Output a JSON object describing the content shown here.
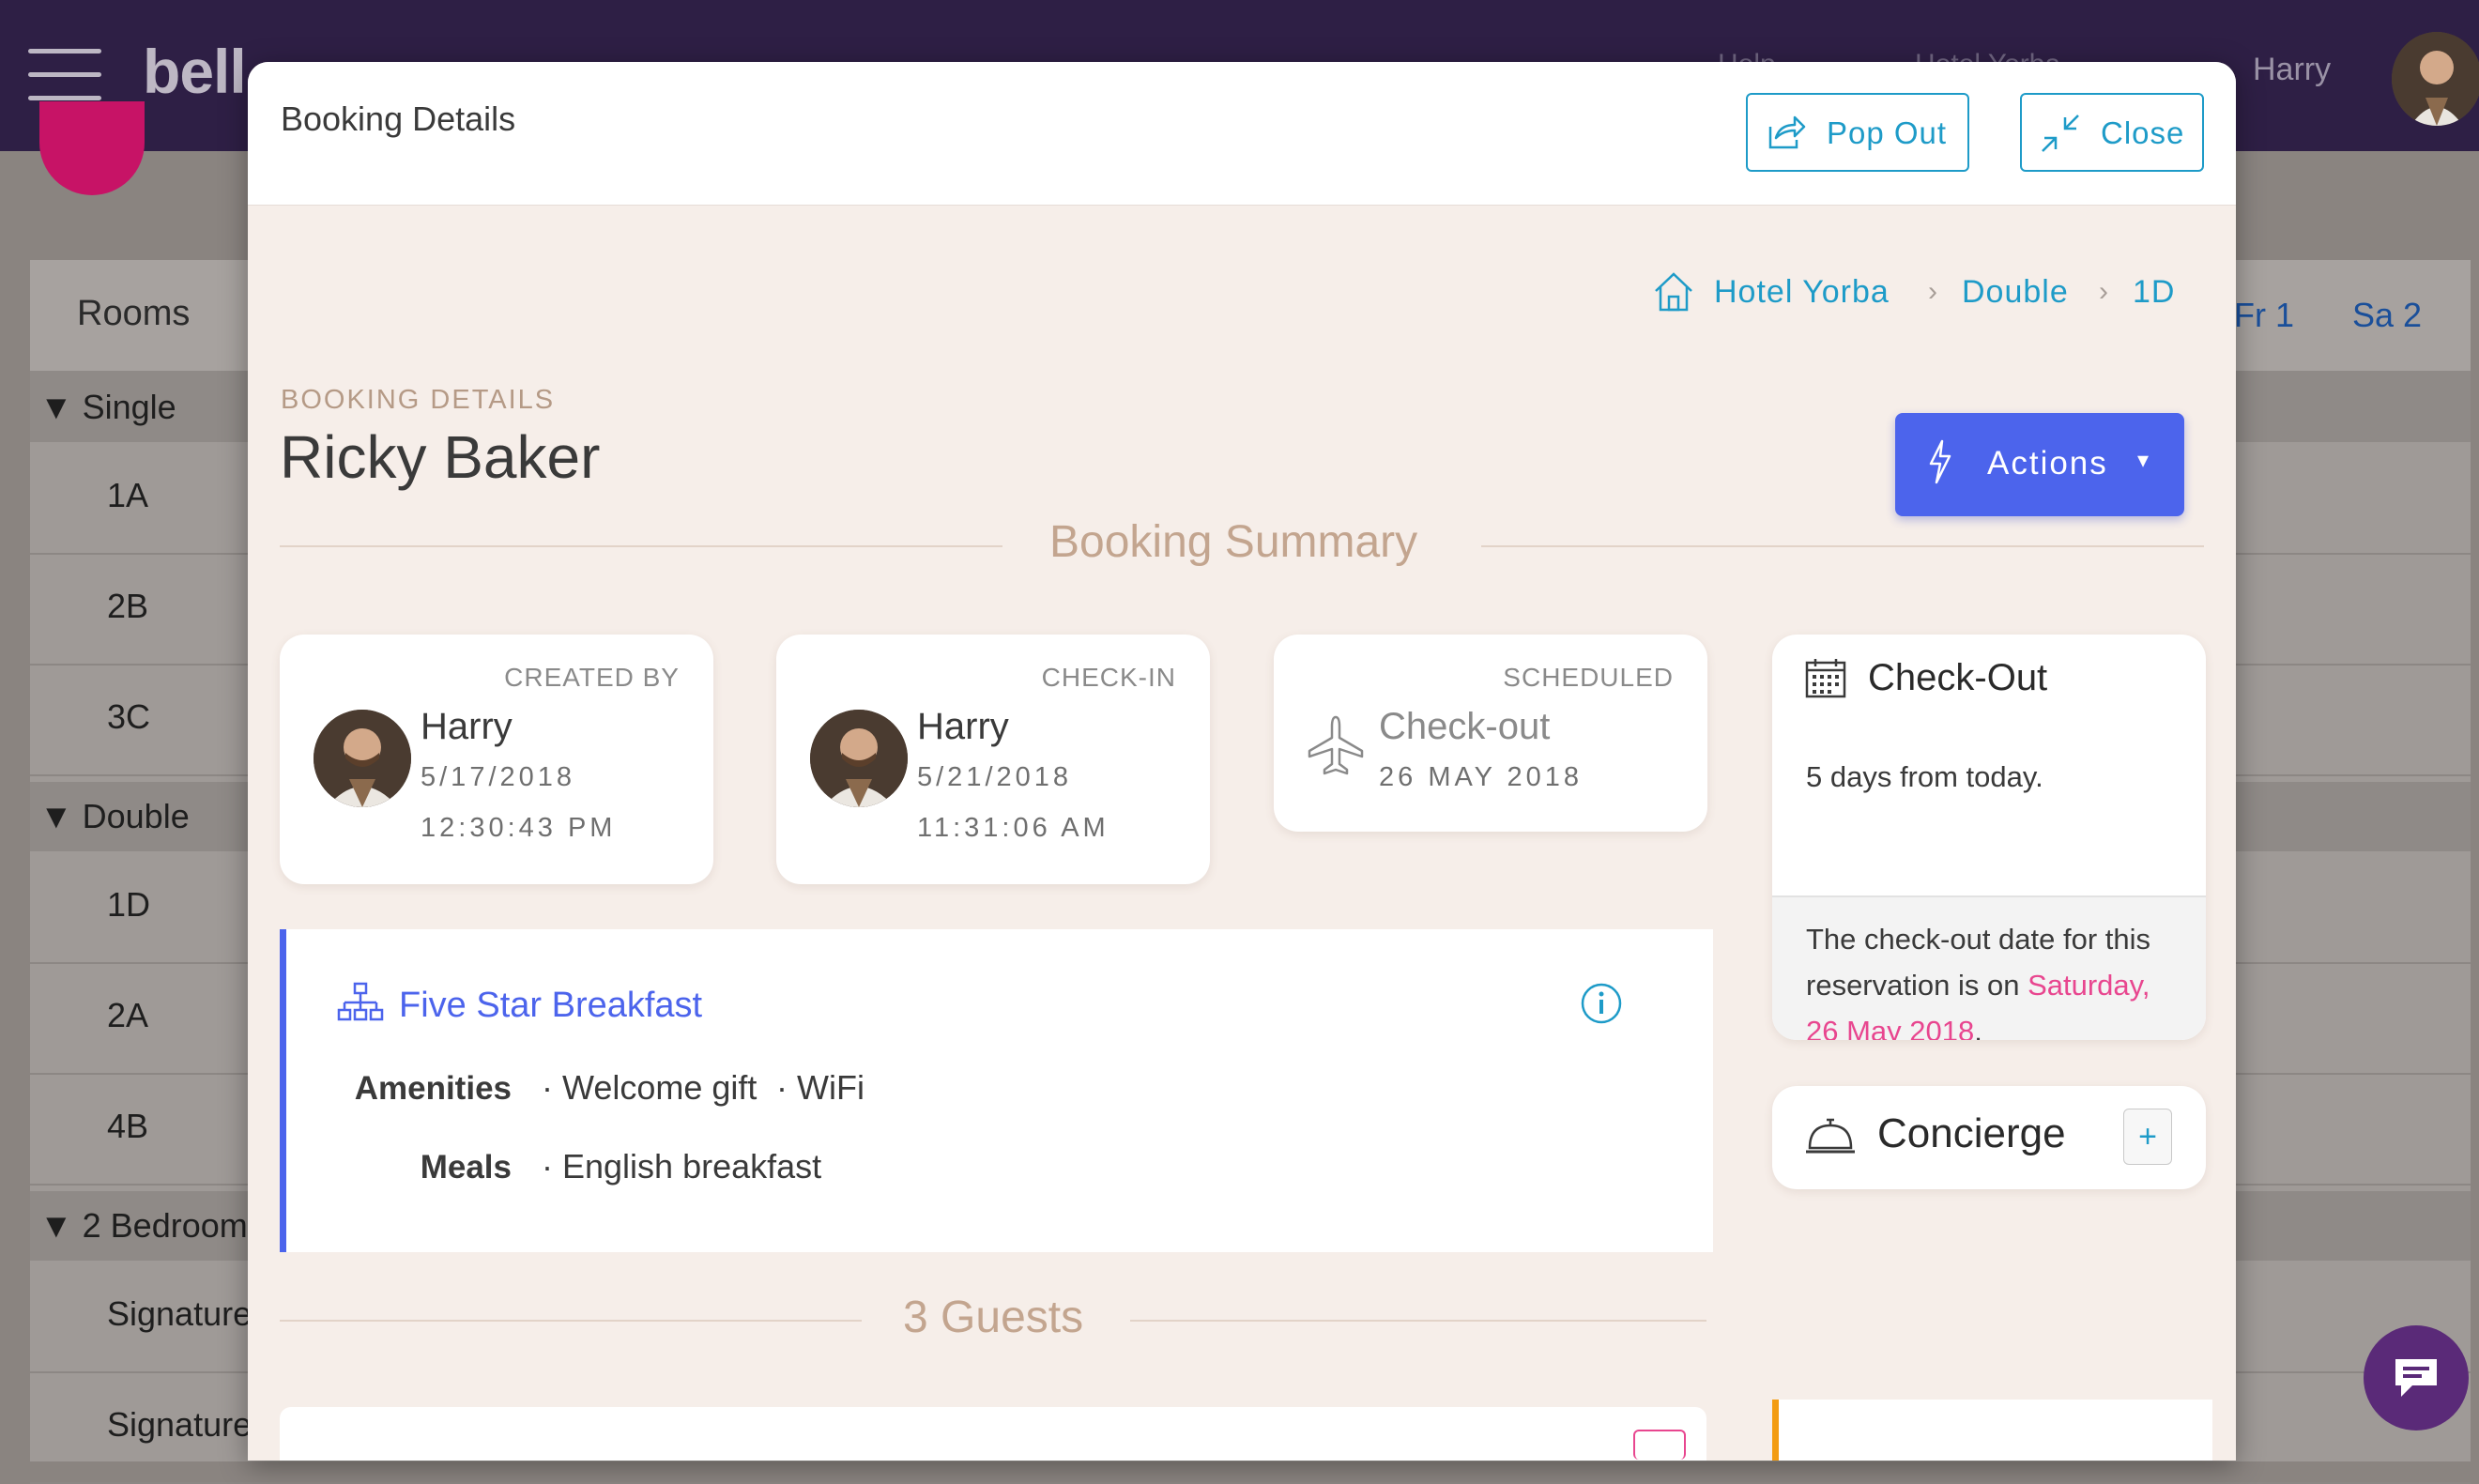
{
  "app": {
    "logo": "bell",
    "user_name": "Harry",
    "faint_nav": [
      "Help",
      "Hotel Yorba"
    ],
    "grid": {
      "rooms_header": "Rooms",
      "days": [
        "Fr 1",
        "Sa 2"
      ],
      "groups": [
        {
          "label": "▼ Single",
          "rooms": [
            "1A",
            "2B",
            "3C"
          ]
        },
        {
          "label": "▼ Double",
          "rooms": [
            "1D",
            "2A",
            "4B"
          ]
        },
        {
          "label": "▼ 2 Bedroom",
          "rooms": [
            "Signature",
            "Signature"
          ]
        }
      ]
    }
  },
  "modal": {
    "title": "Booking Details",
    "pop_out_label": "Pop Out",
    "close_label": "Close",
    "breadcrumb": [
      "Hotel Yorba",
      "Double",
      "1D"
    ],
    "eyebrow": "BOOKING DETAILS",
    "guest_name": "Ricky Baker",
    "actions_label": "Actions",
    "summary_title": "Booking Summary",
    "created": {
      "caption": "CREATED BY",
      "name": "Harry",
      "date": "5/17/2018",
      "time": "12:30:43 PM"
    },
    "checkin": {
      "caption": "CHECK-IN",
      "name": "Harry",
      "date": "5/21/2018",
      "time": "11:31:06 AM"
    },
    "scheduled": {
      "caption": "SCHEDULED",
      "label": "Check-out",
      "date": "26 MAY 2018"
    },
    "package": {
      "title": "Five Star Breakfast",
      "amenities_label": "Amenities",
      "amenities": [
        "· Welcome gift",
        "· WiFi"
      ],
      "meals_label": "Meals",
      "meals": [
        "· English breakfast"
      ]
    },
    "guests_title": "3 Guests",
    "checkout_card": {
      "title": "Check-Out",
      "subtitle": "5 days from today.",
      "note_prefix": "The check-out date for this reservation is on",
      "note_date": "Saturday, 26 May 2018",
      "note_suffix": "."
    },
    "concierge": {
      "title": "Concierge",
      "add_label": "+"
    }
  },
  "colors": {
    "accent_blue": "#4c64ec",
    "link_blue": "#1e9bc8",
    "pink": "#e8468f",
    "topbar": "#2e1f45",
    "modal_bg": "#f6eee9"
  }
}
